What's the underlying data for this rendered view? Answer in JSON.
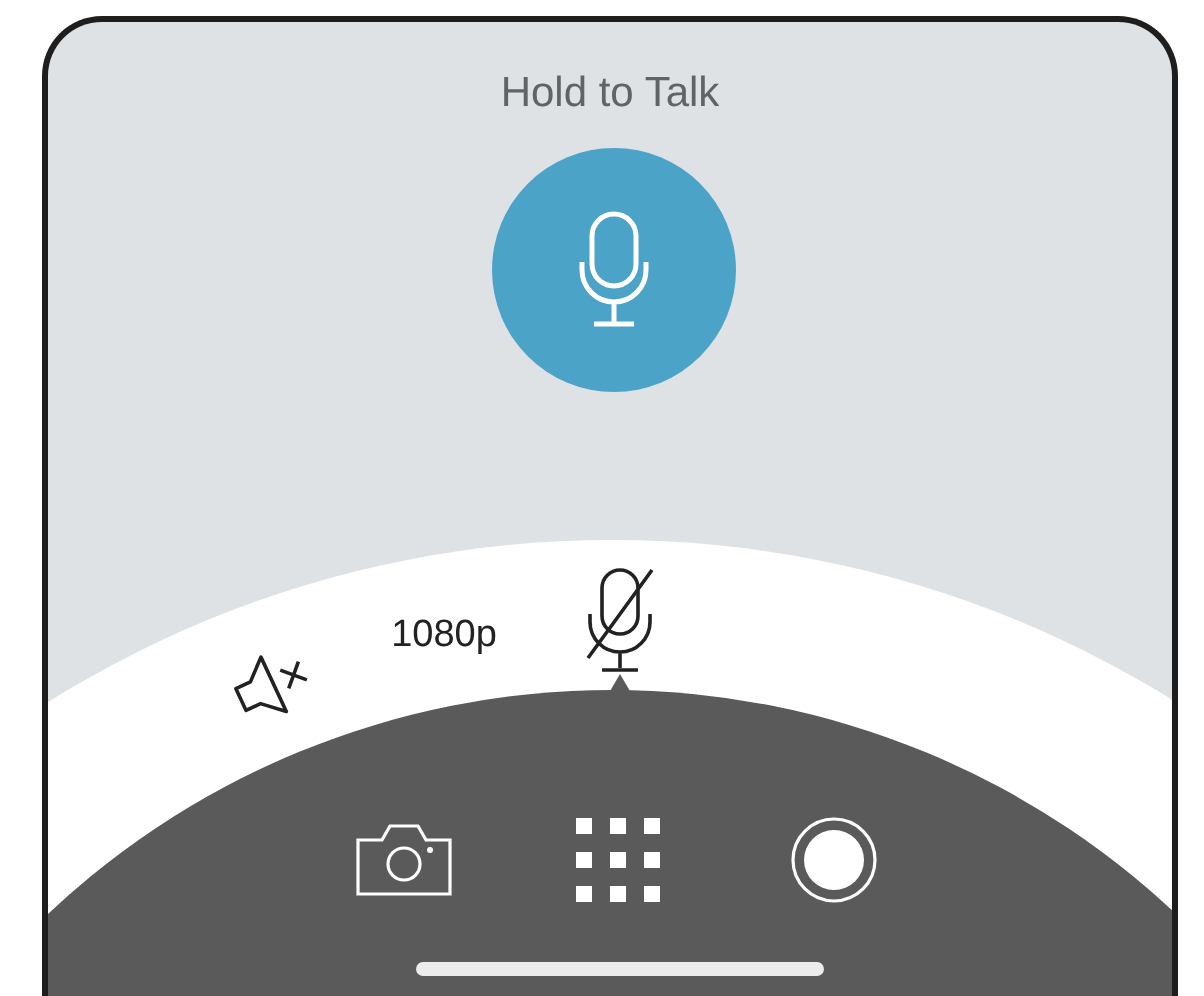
{
  "title": "Hold to Talk",
  "quick_controls": [
    {
      "kind": "speaker-muted",
      "selected": false
    },
    {
      "kind": "text",
      "label": "1080p",
      "selected": false
    },
    {
      "kind": "mic-muted",
      "selected": true
    }
  ],
  "toolbar": [
    {
      "kind": "camera"
    },
    {
      "kind": "grid"
    },
    {
      "kind": "record"
    }
  ]
}
